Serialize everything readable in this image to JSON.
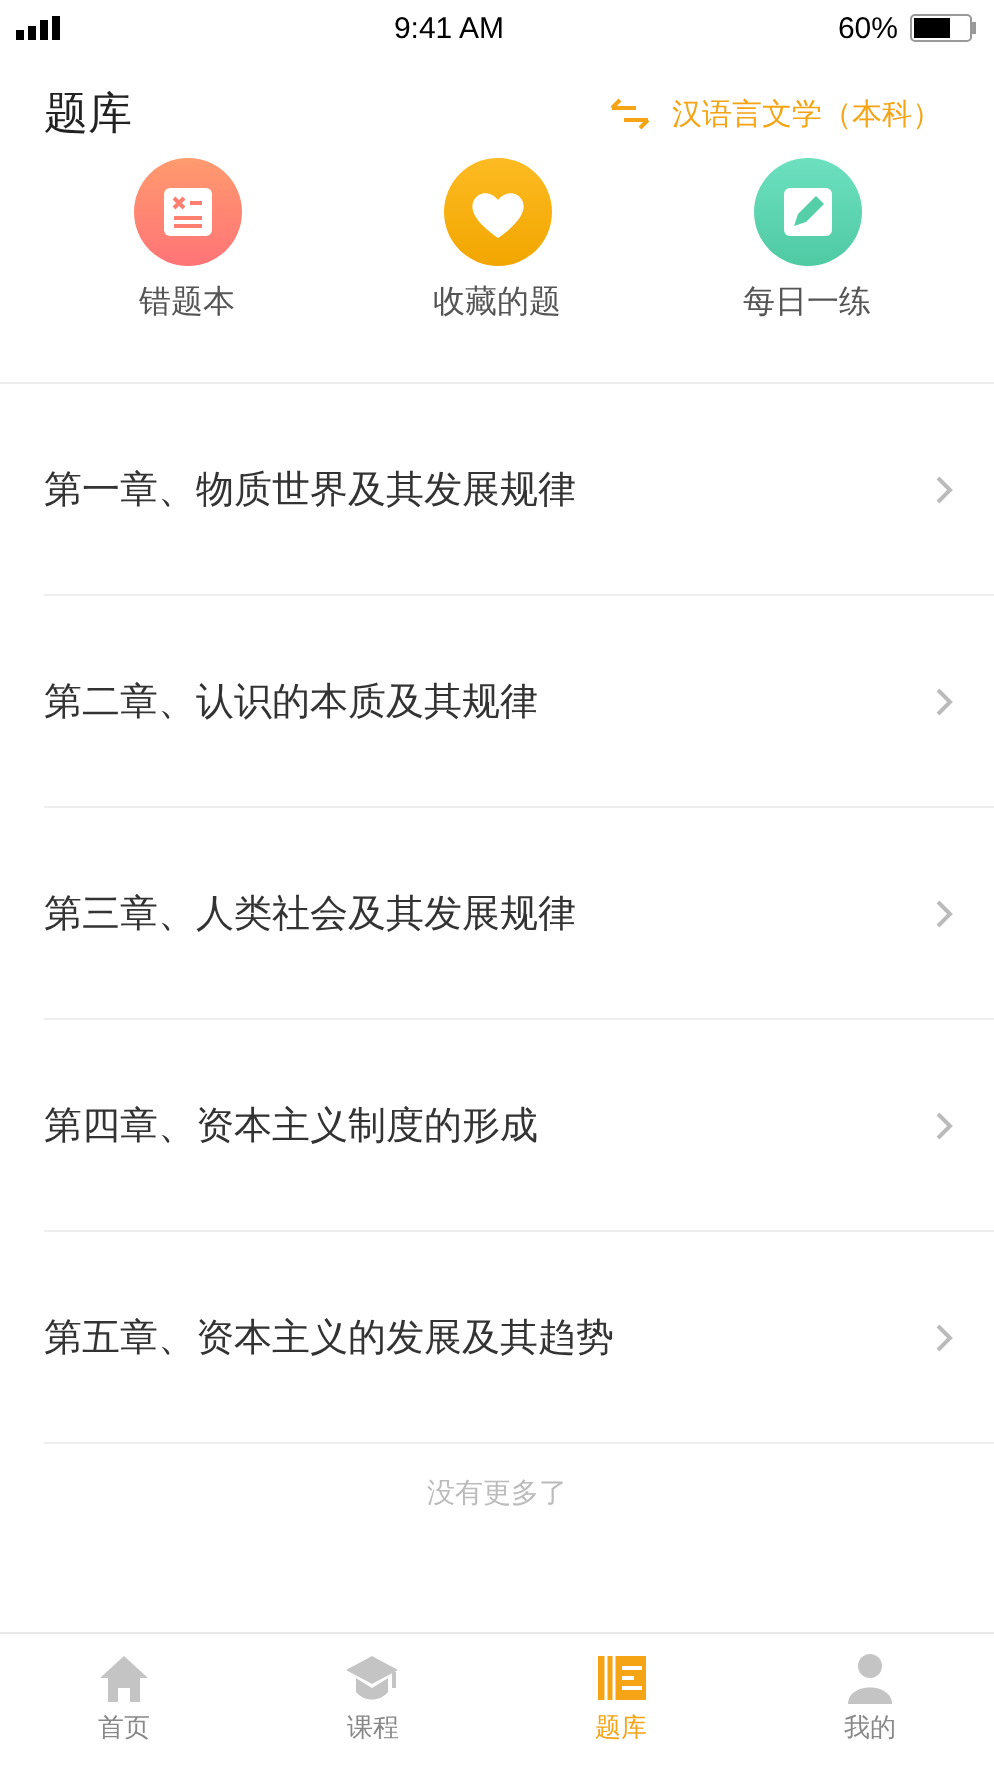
{
  "status_bar": {
    "time": "9:41 AM",
    "battery": "60%"
  },
  "header": {
    "title": "题库",
    "subject": "汉语言文学（本科）"
  },
  "shortcuts": [
    {
      "kind": "wrong",
      "label": "错题本"
    },
    {
      "kind": "favorite",
      "label": "收藏的题"
    },
    {
      "kind": "daily",
      "label": "每日一练"
    }
  ],
  "chapters": [
    "第一章、物质世界及其发展规律",
    "第二章、认识的本质及其规律",
    "第三章、人类社会及其发展规律",
    "第四章、资本主义制度的形成",
    "第五章、资本主义的发展及其趋势"
  ],
  "end_note": "没有更多了",
  "tab_bar": [
    {
      "kind": "home",
      "label": "首页",
      "selected": false
    },
    {
      "kind": "course",
      "label": "课程",
      "selected": false
    },
    {
      "kind": "bank",
      "label": "题库",
      "selected": true
    },
    {
      "kind": "me",
      "label": "我的",
      "selected": false
    }
  ]
}
